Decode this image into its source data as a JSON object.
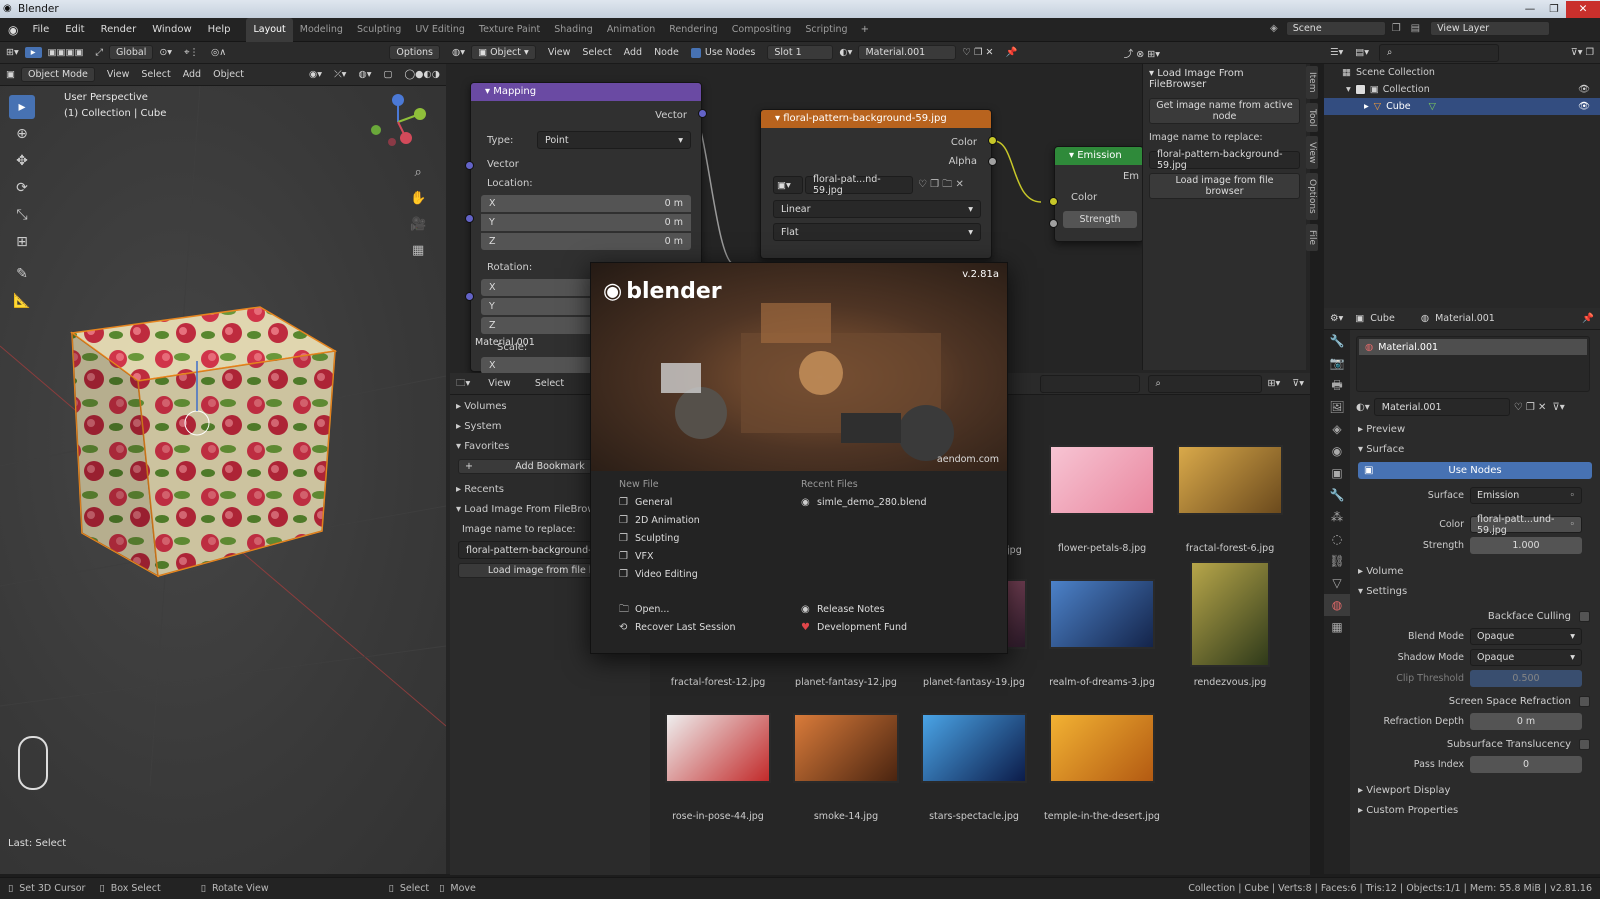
{
  "window": {
    "title": "Blender",
    "min_icon": "minimize-icon",
    "max_icon": "maximize-icon",
    "close_icon": "close-icon"
  },
  "menus": [
    "File",
    "Edit",
    "Render",
    "Window",
    "Help"
  ],
  "workspaces": [
    "Layout",
    "Modeling",
    "Sculpting",
    "UV Editing",
    "Texture Paint",
    "Shading",
    "Animation",
    "Rendering",
    "Compositing",
    "Scripting"
  ],
  "workspace_add": "+",
  "scene": {
    "label": "Scene",
    "view_layer": "View Layer"
  },
  "viewport": {
    "mode": "Object Mode",
    "menus": [
      "View",
      "Select",
      "Add",
      "Object"
    ],
    "transform": "Global",
    "options": "Options",
    "overlay_title": "User Perspective",
    "overlay_sub": "(1) Collection | Cube",
    "last_op": "Last: Select"
  },
  "node_editor": {
    "object_label": "Object",
    "menus": [
      "View",
      "Select",
      "Add",
      "Node"
    ],
    "use_nodes": "Use Nodes",
    "slot": "Slot 1",
    "material": "Material.001",
    "material_tag": "Material.001"
  },
  "mapping_node": {
    "title": "Mapping",
    "vector_out": "Vector",
    "type_label": "Type:",
    "type_value": "Point",
    "vector_in": "Vector",
    "location": "Location:",
    "loc": [
      {
        "axis": "X",
        "val": "0 m"
      },
      {
        "axis": "Y",
        "val": "0 m"
      },
      {
        "axis": "Z",
        "val": "0 m"
      }
    ],
    "rotation": "Rotation:",
    "rot": [
      "X",
      "Y",
      "Z"
    ],
    "scale": "Scale:",
    "scale_x": "X"
  },
  "image_node": {
    "title": "floral-pattern-background-59.jpg",
    "out_color": "Color",
    "out_alpha": "Alpha",
    "image_name": "floral-pat...nd-59.jpg",
    "interp": "Linear",
    "proj": "Flat"
  },
  "emission_node": {
    "title": "Emission",
    "color": "Color",
    "strength": "Strength",
    "out": "Em"
  },
  "sidebar": {
    "header": "Load Image From FileBrowser",
    "get_btn": "Get image name from active node",
    "replace_label": "Image name to replace:",
    "replace_value": "floral-pattern-background-59.jpg",
    "load_btn": "Load image from file browser",
    "tabs": [
      "Item",
      "Tool",
      "View",
      "Options",
      "File"
    ]
  },
  "filebrowser": {
    "menus": [
      "View",
      "Select"
    ],
    "sections": [
      "Volumes",
      "System",
      "Favorites"
    ],
    "add_bookmark": "Add Bookmark",
    "recents": "Recents",
    "panel": "Load Image From FileBrows",
    "replace_label": "Image name to replace:",
    "replace_value": "floral-pattern-background-59.jpg",
    "load_btn": "Load image from file brow",
    "thumbs": [
      {
        "name": "flower-petals-8.jpg",
        "c1": "#f7c4d3",
        "c2": "#e9879f"
      },
      {
        "name": "fractal-forest-6.jpg",
        "c1": "#d9a94a",
        "c2": "#6b4a1d"
      },
      {
        "name": "fractal-forest-12.jpg",
        "c1": "#2a5c7a",
        "c2": "#0d1a24"
      },
      {
        "name": "planet-fantasy-12.jpg",
        "c1": "#e07a2a",
        "c2": "#4a1e0c"
      },
      {
        "name": "planet-fantasy-19.jpg",
        "c1": "#c76b84",
        "c2": "#2b1a2a"
      },
      {
        "name": "realm-of-dreams-3.jpg",
        "c1": "#4c82c9",
        "c2": "#14244a"
      },
      {
        "name": "rendezvous.jpg",
        "c1": "#b7a64a",
        "c2": "#2f3a1a"
      },
      {
        "name": "rose-in-pose-44.jpg",
        "c1": "#eeeeee",
        "c2": "#c22a2a"
      },
      {
        "name": "smoke-14.jpg",
        "c1": "#d97b3a",
        "c2": "#4a2410"
      },
      {
        "name": "stars-spectacle.jpg",
        "c1": "#4aa4e6",
        "c2": "#0c1c4a"
      },
      {
        "name": "temple-in-the-desert.jpg",
        "c1": "#f2b233",
        "c2": "#b35a12"
      }
    ],
    "partial_labels": [
      ".jpg"
    ]
  },
  "splash": {
    "logo": "blender",
    "version": "v.2.81a",
    "credit": "aendom.com",
    "new_file": "New File",
    "new_items": [
      "General",
      "2D Animation",
      "Sculpting",
      "VFX",
      "Video Editing"
    ],
    "recent": "Recent Files",
    "recent_items": [
      "simle_demo_280.blend"
    ],
    "open": "Open...",
    "recover": "Recover Last Session",
    "release": "Release Notes",
    "fund": "Development Fund"
  },
  "outliner": {
    "scene_collection": "Scene Collection",
    "collection": "Collection",
    "cube": "Cube"
  },
  "properties": {
    "object": "Cube",
    "material": "Material.001",
    "slot": "Material.001",
    "mat_field": "Material.001",
    "preview": "Preview",
    "surface_sect": "Surface",
    "use_nodes": "Use Nodes",
    "surface_label": "Surface",
    "surface_value": "Emission",
    "color_label": "Color",
    "color_value": "floral-patt...und-59.jpg",
    "strength_label": "Strength",
    "strength_value": "1.000",
    "volume": "Volume",
    "settings": "Settings",
    "backface": "Backface Culling",
    "blend_label": "Blend Mode",
    "blend_value": "Opaque",
    "shadow_label": "Shadow Mode",
    "shadow_value": "Opaque",
    "clip_label": "Clip Threshold",
    "clip_value": "0.500",
    "ssr": "Screen Space Refraction",
    "refr_label": "Refraction Depth",
    "refr_value": "0 m",
    "sss": "Subsurface Translucency",
    "pass_label": "Pass Index",
    "pass_value": "0",
    "viewport_display": "Viewport Display",
    "custom_props": "Custom Properties"
  },
  "status": {
    "cursor": "Set 3D Cursor",
    "box": "Box Select",
    "rotate": "Rotate View",
    "select": "Select",
    "move": "Move",
    "info": "Collection | Cube | Verts:8 | Faces:6 | Tris:12 | Objects:1/1 | Mem: 55.8 MiB | v2.81.16"
  },
  "colors": {
    "accent": "#4772b3",
    "mapping": "#6a4aa3",
    "texture": "#b8631e",
    "shader": "#2f8a3a",
    "socket_yellow": "#c7c729",
    "socket_vector": "#6363c7",
    "socket_gray": "#a1a1a1"
  }
}
